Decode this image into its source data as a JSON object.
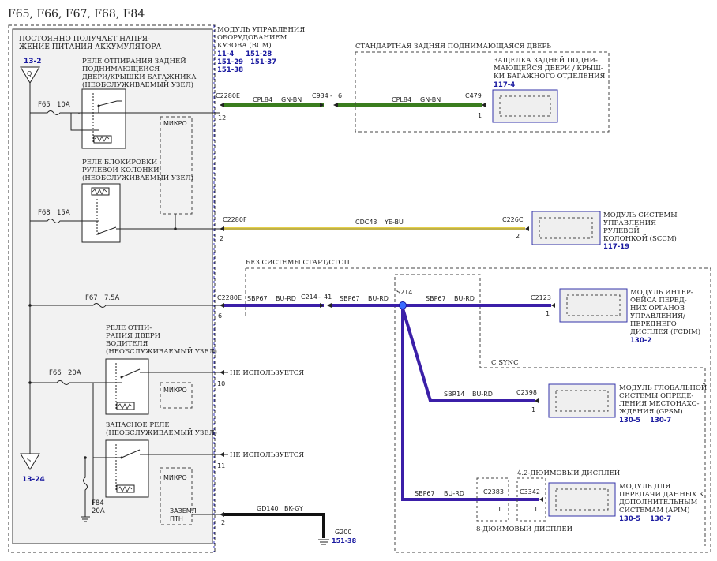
{
  "page_title": "F65, F66, F67, F68, F84",
  "left_panel": {
    "title_1": "ПОСТОЯННО ПОЛУЧАЕТ НАПРЯ-",
    "title_2": "ЖЕНИЕ ПИТАНИЯ АККУМУЛЯТОРА",
    "ref_top": "13-2",
    "ref_bottom": "13-24",
    "q_symbol": "Q",
    "s_symbol": "S"
  },
  "bcm": {
    "line1": "МОДУЛЬ УПРАВЛЕНИЯ",
    "line2": "ОБОРУДОВАНИЕМ",
    "line3": "КУЗОВА (BCM)",
    "refs_row1": "11-4     151-28",
    "refs_row2": "151-29   151-37",
    "refs_row3": "151-38"
  },
  "relays": {
    "liftgate_1": "РЕЛЕ ОТПИРАНИЯ ЗАДНЕЙ",
    "liftgate_2": "ПОДНИМАЮЩЕЙСЯ",
    "liftgate_3": "ДВЕРИ/КРЫШКИ БАГАЖНИКА",
    "liftgate_4": "(НЕОБСЛУЖИВАЕМЫЙ УЗЕЛ)",
    "column_1": "РЕЛЕ БЛОКИРОВКИ",
    "column_2": "РУЛЕВОЙ КОЛОНКИ",
    "column_3": "(НЕОБСЛУЖИВАЕМЫЙ УЗЕЛ)",
    "driver_1": "РЕЛЕ ОТПИ-",
    "driver_2": "РАНИЯ ДВЕРИ",
    "driver_3": "ВОДИТЕЛЯ",
    "driver_4": "(НЕОБСЛУЖИВАЕМЫЙ УЗЕЛ)",
    "spare_1": "ЗАПАСНОЕ РЕЛЕ",
    "spare_2": "(НЕОБСЛУЖИВАЕМЫЙ УЗЕЛ)",
    "micro": "МИКРО",
    "gnd_1": "ЗАЗЕМЛ",
    "gnd_2": "ПТН"
  },
  "fuses": {
    "f65": "F65",
    "f65_a": "10A",
    "f68": "F68",
    "f68_a": "15A",
    "f67": "F67",
    "f67_a": "7.5A",
    "f66": "F66",
    "f66_a": "20A",
    "f84": "F84",
    "f84_a": "20A"
  },
  "connectors": {
    "c2280e_top": "C2280E",
    "pin12": "12",
    "c934": "C934",
    "dash": "-",
    "pin6": "6",
    "c479": "C479",
    "pin1": "1",
    "c2280f": "C2280F",
    "pin2": "2",
    "c226c": "C226C",
    "c2280e_mid": "C2280E",
    "c214": "C214",
    "pin41": "41",
    "s214": "S214",
    "c2123": "C2123",
    "c2398": "C2398",
    "c2383": "C2383",
    "c3342": "C3342",
    "pin10": "10",
    "pin11": "11",
    "g200": "G200",
    "g200_ref": "151-38"
  },
  "wires": {
    "cpl84": "CPL84",
    "gn_bn": "GN-BN",
    "cdc43": "CDC43",
    "ye_bu": "YE-BU",
    "sbp67": "SBP67",
    "bu_rd": "BU-RD",
    "sbr14": "SBR14",
    "gd140": "GD140",
    "bk_gy": "BK-GY",
    "not_used": "НЕ ИСПОЛЬЗУЕТСЯ"
  },
  "modules": {
    "std_liftgate": "СТАНДАРТНАЯ ЗАДНЯЯ ПОДНИМАЮЩАЯСЯ ДВЕРЬ",
    "latch_1": "ЗАЩЕЛКА ЗАДНЕЙ ПОДНИ-",
    "latch_2": "МАЮЩЕЙСЯ ДВЕРИ / КРЫШ-",
    "latch_3": "КИ БАГАЖНОГО ОТДЕЛЕНИЯ",
    "latch_ref": "117-4",
    "sccm_1": "МОДУЛЬ СИСТЕМЫ",
    "sccm_2": "УПРАВЛЕНИЯ",
    "sccm_3": "РУЛЕВОЙ",
    "sccm_4": "КОЛОНКОЙ (SCCM)",
    "sccm_ref": "117-19",
    "no_startstop": "БЕЗ СИСТЕМЫ СТАРТ/СТОП",
    "fcdim_1": "МОДУЛЬ ИНТЕР-",
    "fcdim_2": "ФЕЙСА ПЕРЕД-",
    "fcdim_3": "НИХ ОРГАНОВ",
    "fcdim_4": "УПРАВЛЕНИЯ/",
    "fcdim_5": "ПЕРЕДНЕГО",
    "fcdim_6": "ДИСПЛЕЯ (FCDIM)",
    "fcdim_ref": "130-2",
    "csync": "C SYNC",
    "gpsm_1": "МОДУЛЬ ГЛОБАЛЬНОЙ",
    "gpsm_2": "СИСТЕМЫ ОПРЕДЕ-",
    "gpsm_3": "ЛЕНИЯ МЕСТОНАХО-",
    "gpsm_4": "ЖДЕНИЯ (GPSM)",
    "gpsm_ref": "130-5    130-7",
    "display42": "4.2-ДЮЙМОВЫЙ ДИСПЛЕЙ",
    "display8": "8-ДЮЙМОВЫЙ ДИСПЛЕЙ",
    "apim_1": "МОДУЛЬ ДЛЯ",
    "apim_2": "ПЕРЕДАЧИ ДАННЫХ К",
    "apim_3": "ДОПОЛНИТЕЛЬНЫМ",
    "apim_4": "СИСТЕМАМ (APIM)",
    "apim_ref": "130-5    130-7"
  },
  "colors": {
    "green_wire": "#3a7d1e",
    "yellow_wire": "#e4d04a",
    "blue_wire": "#3b1fa8",
    "black_wire": "#111111",
    "module_border": "#3333aa"
  }
}
